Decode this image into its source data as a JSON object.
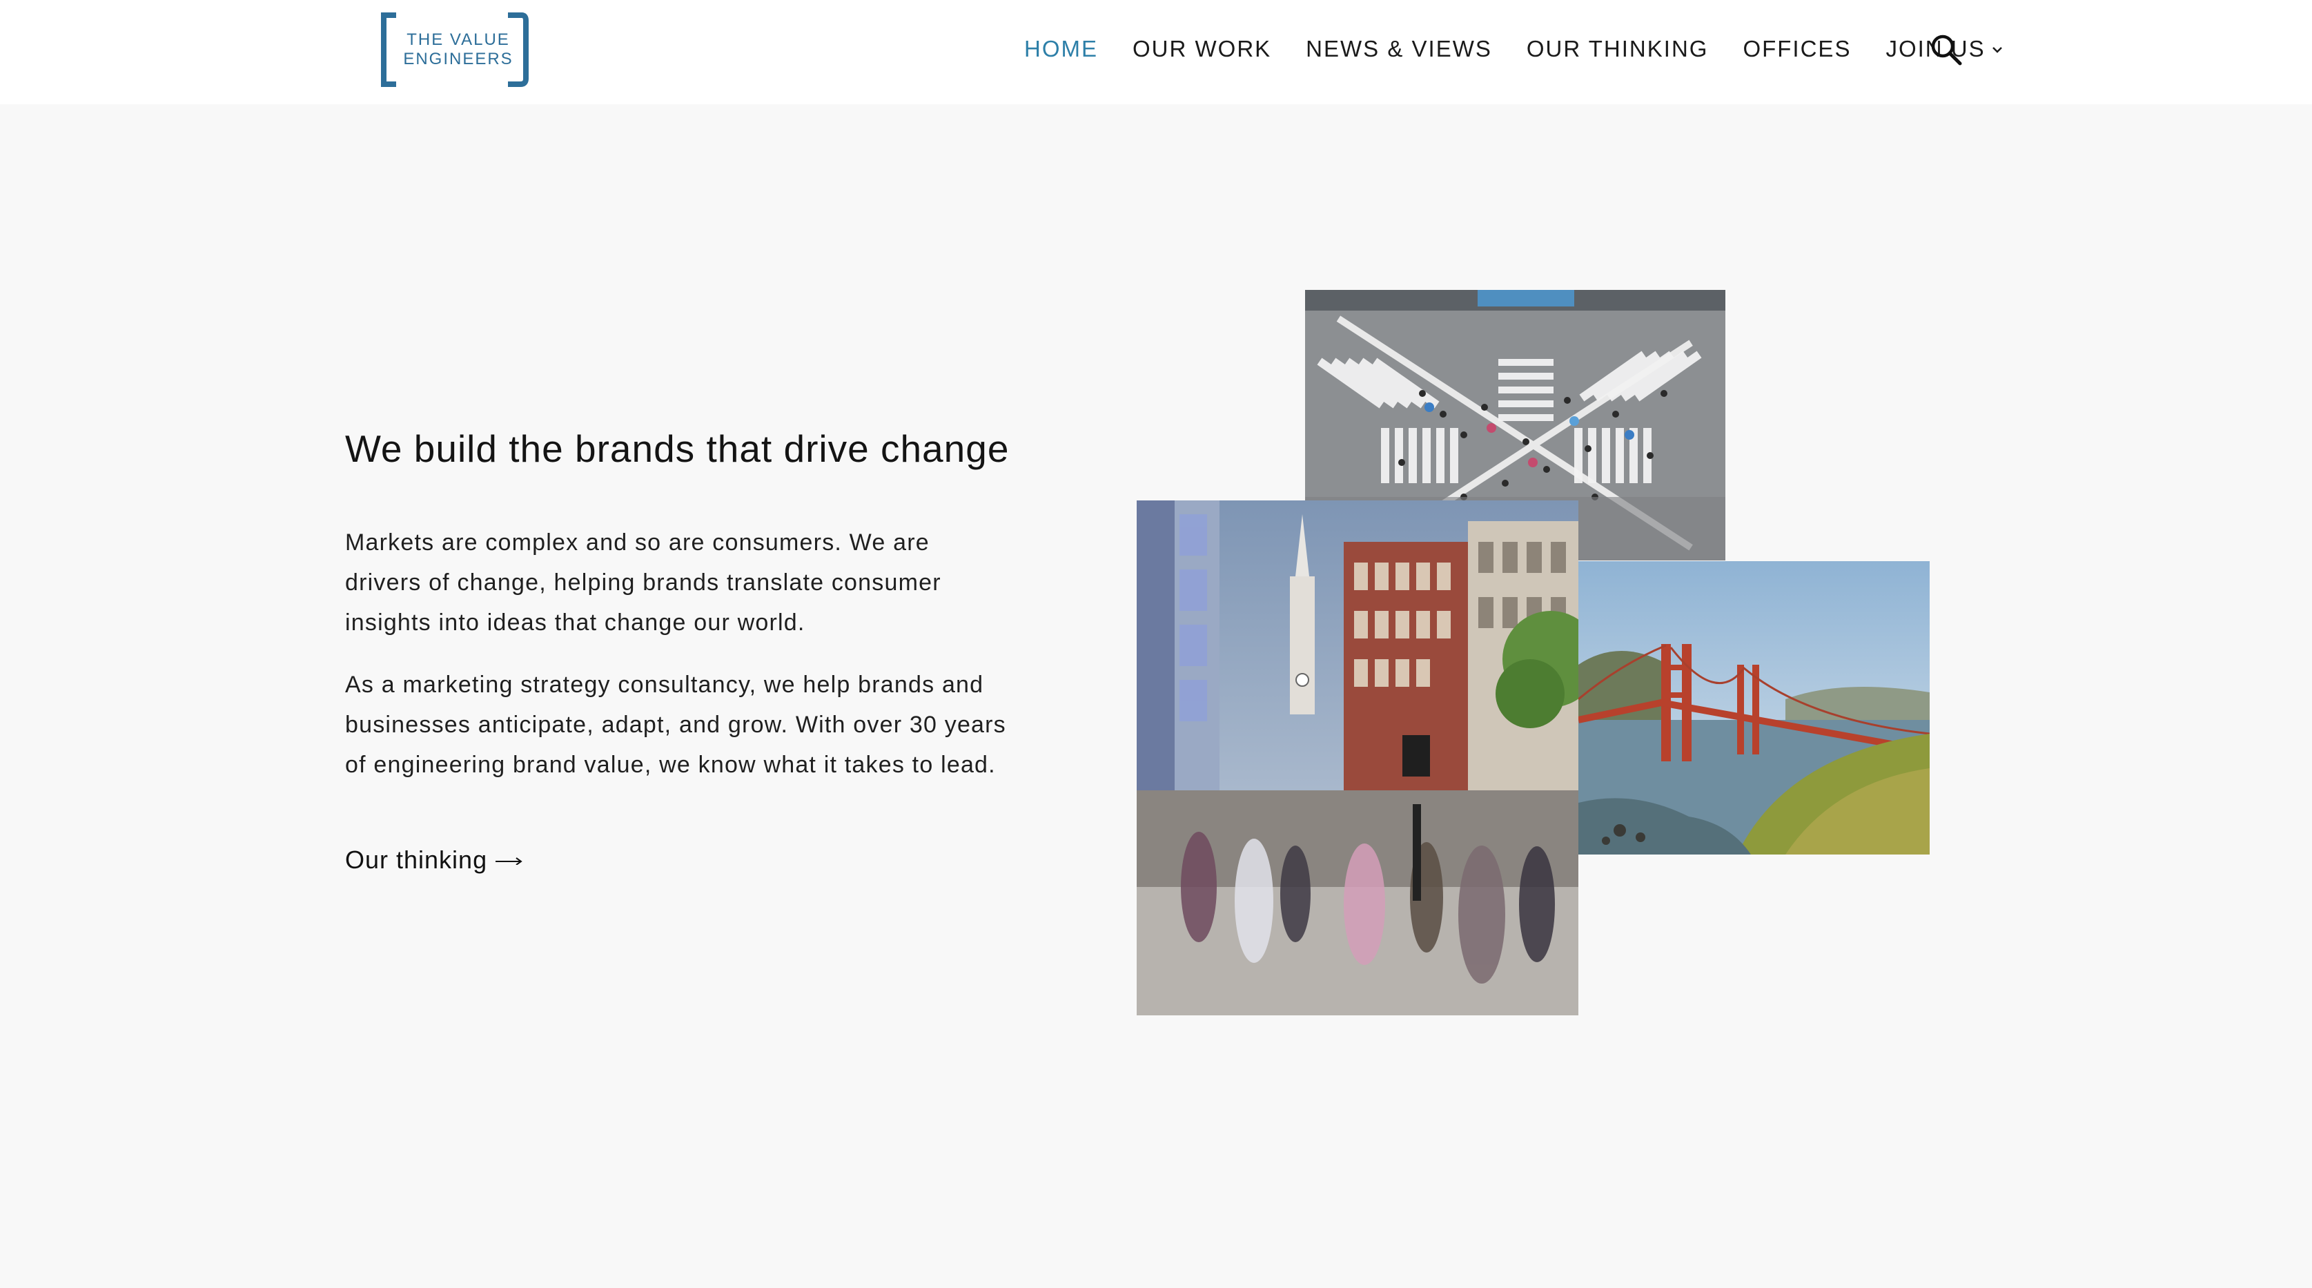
{
  "header": {
    "logo": {
      "line1": "THE VALUE",
      "line2": "ENGINEERS",
      "color": "#2d6e99"
    },
    "nav": [
      {
        "label": "HOME",
        "active": true
      },
      {
        "label": "OUR WORK",
        "active": false
      },
      {
        "label": "NEWS & VIEWS",
        "active": false
      },
      {
        "label": "OUR THINKING",
        "active": false
      },
      {
        "label": "OFFICES",
        "active": false
      },
      {
        "label": "JOIN US",
        "active": false,
        "icon": "chevron-down-icon"
      }
    ],
    "search_icon": "search-icon"
  },
  "hero": {
    "title": "We build the brands that drive change",
    "paragraph1": "Markets are complex and so are consumers. We are drivers of change, helping brands translate consumer insights into ideas that change our world.",
    "paragraph2": "As a marketing strategy consultancy, we help brands and businesses anticipate, adapt, and grow. With over 30 years of engineering brand value, we know what it takes to lead.",
    "cta_label": "Our thinking",
    "cta_icon": "arrow-right-icon"
  },
  "colors": {
    "accent": "#2d7fa8",
    "background": "#f8f8f8",
    "header_bg": "#ffffff"
  }
}
